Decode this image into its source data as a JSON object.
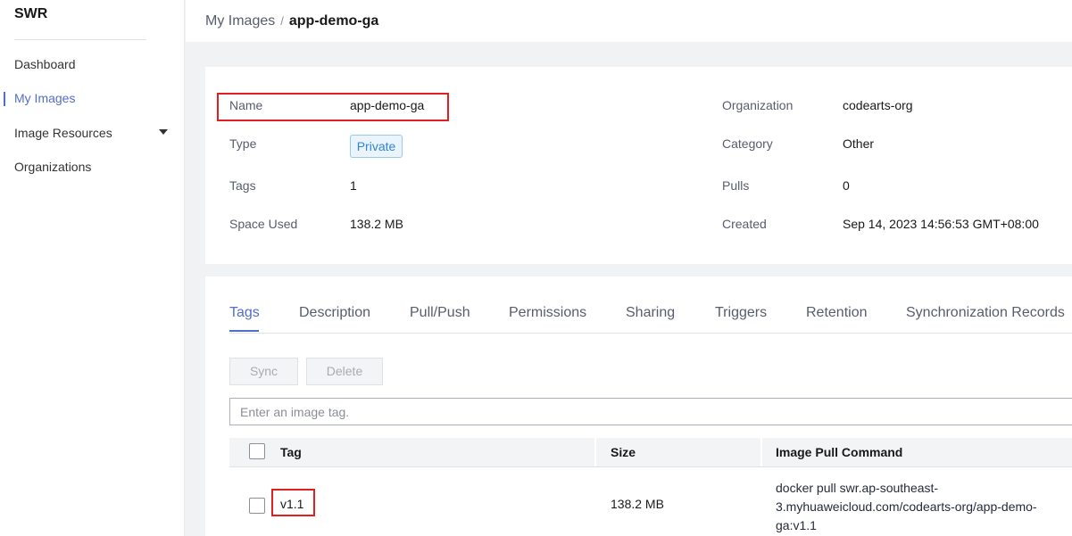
{
  "sidebar": {
    "brand": "SWR",
    "items": [
      {
        "label": "Dashboard"
      },
      {
        "label": "My Images"
      },
      {
        "label": "Image Resources"
      },
      {
        "label": "Organizations"
      }
    ]
  },
  "breadcrumb": {
    "parent": "My Images",
    "separator": "/",
    "current": "app-demo-ga"
  },
  "info": {
    "name_label": "Name",
    "name_value": "app-demo-ga",
    "type_label": "Type",
    "type_value": "Private",
    "tags_label": "Tags",
    "tags_value": "1",
    "space_label": "Space Used",
    "space_value": "138.2 MB",
    "org_label": "Organization",
    "org_value": "codearts-org",
    "category_label": "Category",
    "category_value": "Other",
    "pulls_label": "Pulls",
    "pulls_value": "0",
    "created_label": "Created",
    "created_value": "Sep 14, 2023 14:56:53 GMT+08:00"
  },
  "tabs": [
    {
      "label": "Tags"
    },
    {
      "label": "Description"
    },
    {
      "label": "Pull/Push"
    },
    {
      "label": "Permissions"
    },
    {
      "label": "Sharing"
    },
    {
      "label": "Triggers"
    },
    {
      "label": "Retention"
    },
    {
      "label": "Synchronization Records"
    }
  ],
  "toolbar": {
    "sync_label": "Sync",
    "delete_label": "Delete",
    "search_placeholder": "Enter an image tag."
  },
  "table": {
    "headers": {
      "tag": "Tag",
      "size": "Size",
      "command": "Image Pull Command"
    },
    "rows": [
      {
        "tag": "v1.1",
        "size": "138.2 MB",
        "command": "docker pull swr.ap-southeast-3.myhuaweicloud.com/codearts-org/app-demo-ga:v1.1"
      }
    ]
  },
  "colors": {
    "accent": "#526ecc",
    "highlight_box": "#e02020",
    "badge_text": "#3185d7"
  }
}
